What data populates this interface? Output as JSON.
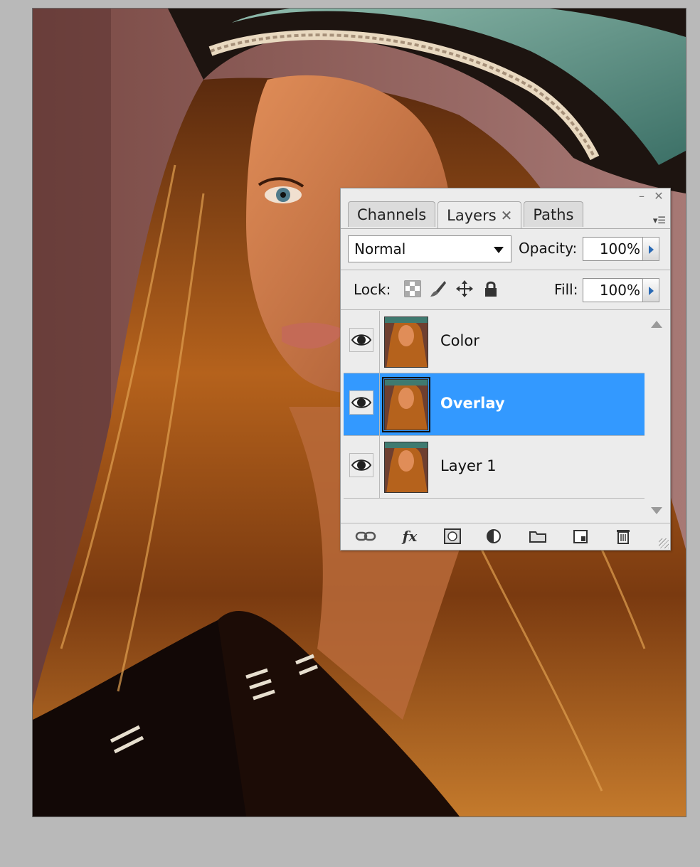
{
  "canvas": {
    "description_icon": "photo-canvas"
  },
  "panel": {
    "minimize_glyph": "–",
    "close_glyph": "✕",
    "menu_glyph": "▾☰",
    "tabs": [
      {
        "label": "Channels",
        "active": false
      },
      {
        "label": "Layers",
        "active": true,
        "close": "✕"
      },
      {
        "label": "Paths",
        "active": false
      }
    ],
    "blend_mode": "Normal",
    "opacity_label": "Opacity:",
    "opacity_value": "100%",
    "lock_label": "Lock:",
    "lock_icons": [
      "lock-transparent-pixels-icon",
      "lock-image-pixels-icon",
      "lock-position-icon",
      "lock-all-icon"
    ],
    "fill_label": "Fill:",
    "fill_value": "100%",
    "layers": [
      {
        "name": "Color",
        "visible": true,
        "selected": false
      },
      {
        "name": "Overlay",
        "visible": true,
        "selected": true
      },
      {
        "name": "Layer 1",
        "visible": true,
        "selected": false
      }
    ],
    "bottom_icons": [
      "link-layers-icon",
      "fx-icon",
      "layer-mask-icon",
      "adjustment-layer-icon",
      "new-group-icon",
      "new-layer-icon",
      "delete-layer-icon"
    ],
    "fx_label": "fx",
    "selection_color": "#3399ff"
  }
}
